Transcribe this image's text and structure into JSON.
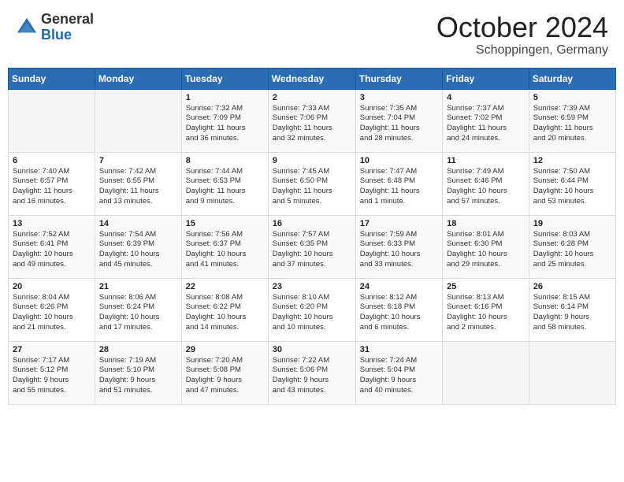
{
  "header": {
    "logo_general": "General",
    "logo_blue": "Blue",
    "month": "October 2024",
    "location": "Schoppingen, Germany"
  },
  "weekdays": [
    "Sunday",
    "Monday",
    "Tuesday",
    "Wednesday",
    "Thursday",
    "Friday",
    "Saturday"
  ],
  "weeks": [
    [
      {
        "day": "",
        "detail": ""
      },
      {
        "day": "",
        "detail": ""
      },
      {
        "day": "1",
        "detail": "Sunrise: 7:32 AM\nSunset: 7:09 PM\nDaylight: 11 hours\nand 36 minutes."
      },
      {
        "day": "2",
        "detail": "Sunrise: 7:33 AM\nSunset: 7:06 PM\nDaylight: 11 hours\nand 32 minutes."
      },
      {
        "day": "3",
        "detail": "Sunrise: 7:35 AM\nSunset: 7:04 PM\nDaylight: 11 hours\nand 28 minutes."
      },
      {
        "day": "4",
        "detail": "Sunrise: 7:37 AM\nSunset: 7:02 PM\nDaylight: 11 hours\nand 24 minutes."
      },
      {
        "day": "5",
        "detail": "Sunrise: 7:39 AM\nSunset: 6:59 PM\nDaylight: 11 hours\nand 20 minutes."
      }
    ],
    [
      {
        "day": "6",
        "detail": "Sunrise: 7:40 AM\nSunset: 6:57 PM\nDaylight: 11 hours\nand 16 minutes."
      },
      {
        "day": "7",
        "detail": "Sunrise: 7:42 AM\nSunset: 6:55 PM\nDaylight: 11 hours\nand 13 minutes."
      },
      {
        "day": "8",
        "detail": "Sunrise: 7:44 AM\nSunset: 6:53 PM\nDaylight: 11 hours\nand 9 minutes."
      },
      {
        "day": "9",
        "detail": "Sunrise: 7:45 AM\nSunset: 6:50 PM\nDaylight: 11 hours\nand 5 minutes."
      },
      {
        "day": "10",
        "detail": "Sunrise: 7:47 AM\nSunset: 6:48 PM\nDaylight: 11 hours\nand 1 minute."
      },
      {
        "day": "11",
        "detail": "Sunrise: 7:49 AM\nSunset: 6:46 PM\nDaylight: 10 hours\nand 57 minutes."
      },
      {
        "day": "12",
        "detail": "Sunrise: 7:50 AM\nSunset: 6:44 PM\nDaylight: 10 hours\nand 53 minutes."
      }
    ],
    [
      {
        "day": "13",
        "detail": "Sunrise: 7:52 AM\nSunset: 6:41 PM\nDaylight: 10 hours\nand 49 minutes."
      },
      {
        "day": "14",
        "detail": "Sunrise: 7:54 AM\nSunset: 6:39 PM\nDaylight: 10 hours\nand 45 minutes."
      },
      {
        "day": "15",
        "detail": "Sunrise: 7:56 AM\nSunset: 6:37 PM\nDaylight: 10 hours\nand 41 minutes."
      },
      {
        "day": "16",
        "detail": "Sunrise: 7:57 AM\nSunset: 6:35 PM\nDaylight: 10 hours\nand 37 minutes."
      },
      {
        "day": "17",
        "detail": "Sunrise: 7:59 AM\nSunset: 6:33 PM\nDaylight: 10 hours\nand 33 minutes."
      },
      {
        "day": "18",
        "detail": "Sunrise: 8:01 AM\nSunset: 6:30 PM\nDaylight: 10 hours\nand 29 minutes."
      },
      {
        "day": "19",
        "detail": "Sunrise: 8:03 AM\nSunset: 6:28 PM\nDaylight: 10 hours\nand 25 minutes."
      }
    ],
    [
      {
        "day": "20",
        "detail": "Sunrise: 8:04 AM\nSunset: 6:26 PM\nDaylight: 10 hours\nand 21 minutes."
      },
      {
        "day": "21",
        "detail": "Sunrise: 8:06 AM\nSunset: 6:24 PM\nDaylight: 10 hours\nand 17 minutes."
      },
      {
        "day": "22",
        "detail": "Sunrise: 8:08 AM\nSunset: 6:22 PM\nDaylight: 10 hours\nand 14 minutes."
      },
      {
        "day": "23",
        "detail": "Sunrise: 8:10 AM\nSunset: 6:20 PM\nDaylight: 10 hours\nand 10 minutes."
      },
      {
        "day": "24",
        "detail": "Sunrise: 8:12 AM\nSunset: 6:18 PM\nDaylight: 10 hours\nand 6 minutes."
      },
      {
        "day": "25",
        "detail": "Sunrise: 8:13 AM\nSunset: 6:16 PM\nDaylight: 10 hours\nand 2 minutes."
      },
      {
        "day": "26",
        "detail": "Sunrise: 8:15 AM\nSunset: 6:14 PM\nDaylight: 9 hours\nand 58 minutes."
      }
    ],
    [
      {
        "day": "27",
        "detail": "Sunrise: 7:17 AM\nSunset: 5:12 PM\nDaylight: 9 hours\nand 55 minutes."
      },
      {
        "day": "28",
        "detail": "Sunrise: 7:19 AM\nSunset: 5:10 PM\nDaylight: 9 hours\nand 51 minutes."
      },
      {
        "day": "29",
        "detail": "Sunrise: 7:20 AM\nSunset: 5:08 PM\nDaylight: 9 hours\nand 47 minutes."
      },
      {
        "day": "30",
        "detail": "Sunrise: 7:22 AM\nSunset: 5:06 PM\nDaylight: 9 hours\nand 43 minutes."
      },
      {
        "day": "31",
        "detail": "Sunrise: 7:24 AM\nSunset: 5:04 PM\nDaylight: 9 hours\nand 40 minutes."
      },
      {
        "day": "",
        "detail": ""
      },
      {
        "day": "",
        "detail": ""
      }
    ]
  ]
}
